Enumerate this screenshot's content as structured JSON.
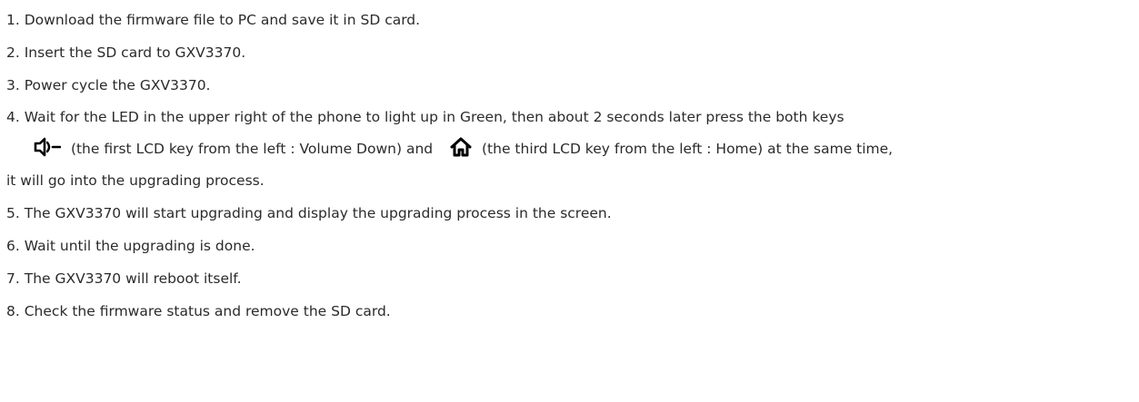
{
  "steps": [
    {
      "num": "1.",
      "text": "Download the firmware file to PC and save it in SD card."
    },
    {
      "num": "2.",
      "text": "Insert the SD card to GXV3370."
    },
    {
      "num": "3.",
      "text": "Power cycle the GXV3370."
    },
    {
      "num": "4.",
      "line1": "Wait for the LED in the upper right of the phone to light up in Green, then about 2 seconds later press the both keys",
      "key1_desc": "(the first LCD key from the left : Volume Down) and",
      "key2_desc": "(the third LCD key from the left : Home) at the same time,",
      "line3": "it will go into the upgrading process.",
      "key1_icon": "volume-down-icon",
      "key2_icon": "home-icon"
    },
    {
      "num": "5.",
      "text": "The GXV3370 will start upgrading and display the upgrading process in the screen."
    },
    {
      "num": "6.",
      "text": "Wait until the upgrading is done."
    },
    {
      "num": "7.",
      "text": "The GXV3370 will reboot itself."
    },
    {
      "num": "8.",
      "text": "Check the firmware status and remove the SD card."
    }
  ]
}
